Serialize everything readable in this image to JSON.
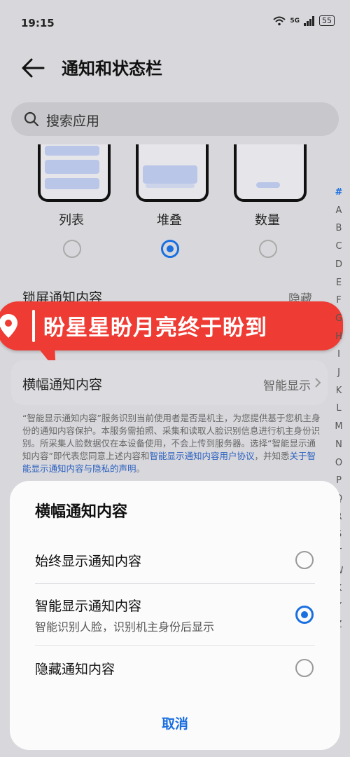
{
  "status_bar": {
    "time": "19:15",
    "network": "5G",
    "battery": "55"
  },
  "header": {
    "title": "通知和状态栏"
  },
  "search": {
    "placeholder": "搜索应用"
  },
  "notification_styles": [
    {
      "label": "列表",
      "selected": false
    },
    {
      "label": "堆叠",
      "selected": true
    },
    {
      "label": "数量",
      "selected": false
    }
  ],
  "lock_screen_row": {
    "label": "锁屏通知内容",
    "value": "隐藏"
  },
  "overlay_banner": {
    "text": "盼星星盼月亮终于盼到",
    "color": "#ee3b33"
  },
  "banner_row": {
    "label": "横幅通知内容",
    "value": "智能显示"
  },
  "privacy_note": {
    "text": "“智能显示通知内容”服务识别当前使用者是否是机主，为您提供基于您机主身份的通知内容保护。本服务需拍照、采集和读取人脸识别信息进行机主身份识别。所采集人脸数据仅在本设备使用，不会上传到服务器。选择“智能显示通知内容”即代表您同意上述内容和",
    "link1": "智能显示通知内容用户协议",
    "middle": "，并知悉",
    "link2": "关于智能显示通知内容与隐私的声明",
    "end": "。"
  },
  "alpha_index": [
    "#",
    "A",
    "B",
    "C",
    "D",
    "E",
    "F",
    "G",
    "H",
    "I",
    "J",
    "K",
    "L",
    "M",
    "N",
    "O",
    "P",
    "Q",
    "R",
    "S",
    "T",
    "W",
    "X",
    "Y",
    "Z"
  ],
  "sheet": {
    "title": "横幅通知内容",
    "options": [
      {
        "title": "始终显示通知内容",
        "subtitle": "",
        "selected": false
      },
      {
        "title": "智能显示通知内容",
        "subtitle": "智能识别人脸，识别机主身份后显示",
        "selected": true
      },
      {
        "title": "隐藏通知内容",
        "subtitle": "",
        "selected": false
      }
    ],
    "cancel_label": "取消"
  },
  "accent_color": "#1a6fe0"
}
